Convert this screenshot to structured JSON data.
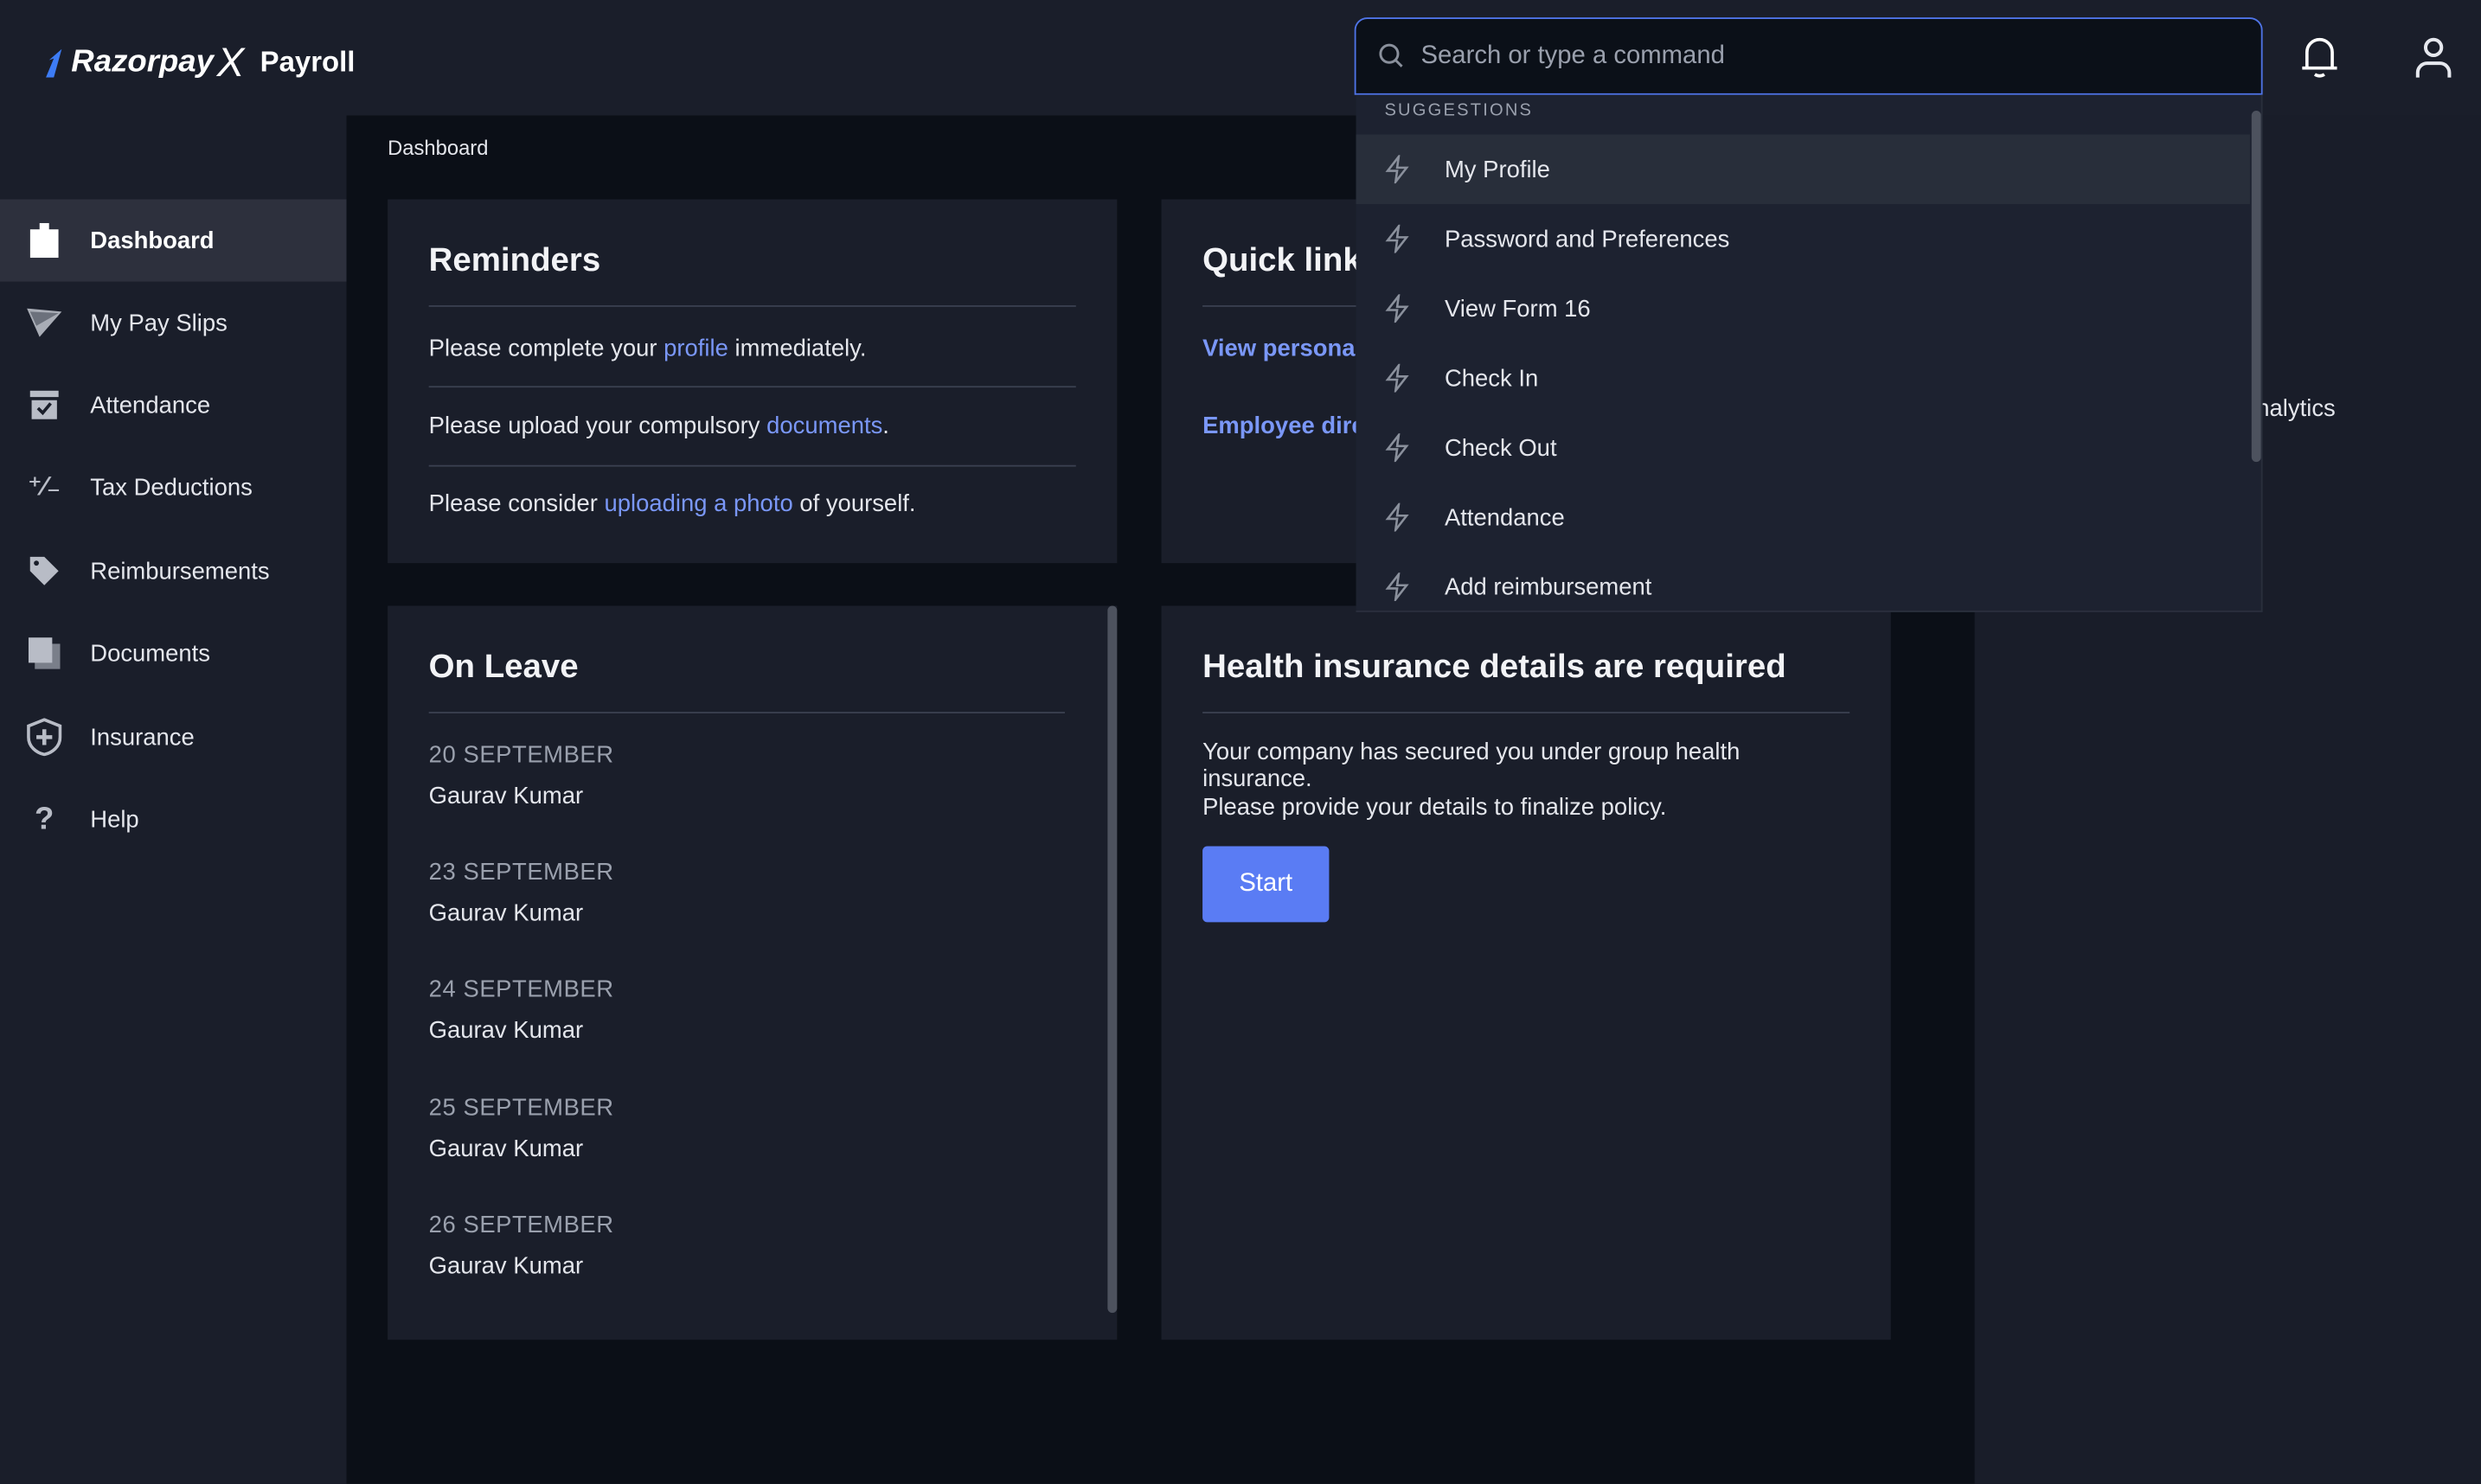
{
  "header": {
    "logo": {
      "brand": "Razorpay",
      "brand_x": "X",
      "product": "Payroll"
    },
    "search": {
      "placeholder": "Search or type a command",
      "value": ""
    },
    "icons": [
      "bell-icon",
      "user-icon"
    ]
  },
  "sidebar": {
    "items": [
      {
        "label": "Dashboard",
        "icon": "clipboard-icon",
        "active": true
      },
      {
        "label": "My Pay Slips",
        "icon": "paper-plane-icon"
      },
      {
        "label": "Attendance",
        "icon": "calendar-check-icon"
      },
      {
        "label": "Tax Deductions",
        "icon": "percent-icon"
      },
      {
        "label": "Reimbursements",
        "icon": "tag-icon"
      },
      {
        "label": "Documents",
        "icon": "documents-icon"
      },
      {
        "label": "Insurance",
        "icon": "shield-plus-icon"
      },
      {
        "label": "Help",
        "icon": "question-icon"
      }
    ]
  },
  "breadcrumb": "Dashboard",
  "reminders": {
    "title": "Reminders",
    "items": [
      {
        "before": "Please complete your ",
        "link": "profile",
        "after": " immediately."
      },
      {
        "before": "Please upload your compulsory ",
        "link": "documents",
        "after": "."
      },
      {
        "before": "Please consider ",
        "link": "uploading a photo",
        "after": " of yourself."
      }
    ]
  },
  "quick_links": {
    "title": "Quick links",
    "links": [
      "View personal details",
      "Employee directory"
    ]
  },
  "on_leave": {
    "title": "On Leave",
    "entries": [
      {
        "date": "20 SEPTEMBER",
        "name": "Gaurav Kumar"
      },
      {
        "date": "23 SEPTEMBER",
        "name": "Gaurav Kumar"
      },
      {
        "date": "24 SEPTEMBER",
        "name": "Gaurav Kumar"
      },
      {
        "date": "25 SEPTEMBER",
        "name": "Gaurav Kumar"
      },
      {
        "date": "26 SEPTEMBER",
        "name": "Gaurav Kumar"
      }
    ]
  },
  "health": {
    "title": "Health insurance details are required",
    "line1": "Your company has secured you under group health insurance.",
    "line2": "Please provide your details to finalize policy.",
    "button": "Start"
  },
  "right_pane": {
    "label": "Analytics"
  },
  "suggestions": {
    "heading": "SUGGESTIONS",
    "items": [
      "My Profile",
      "Password and Preferences",
      "View Form 16",
      "Check In",
      "Check Out",
      "Attendance",
      "Add reimbursement"
    ]
  },
  "colors": {
    "accent": "#5a7cf4",
    "link": "#7a97f7",
    "bg_main": "#0b0f17",
    "bg_panel": "#1a1e2a",
    "search_border": "#4f74e8",
    "logo_x": "#f06c2a"
  }
}
